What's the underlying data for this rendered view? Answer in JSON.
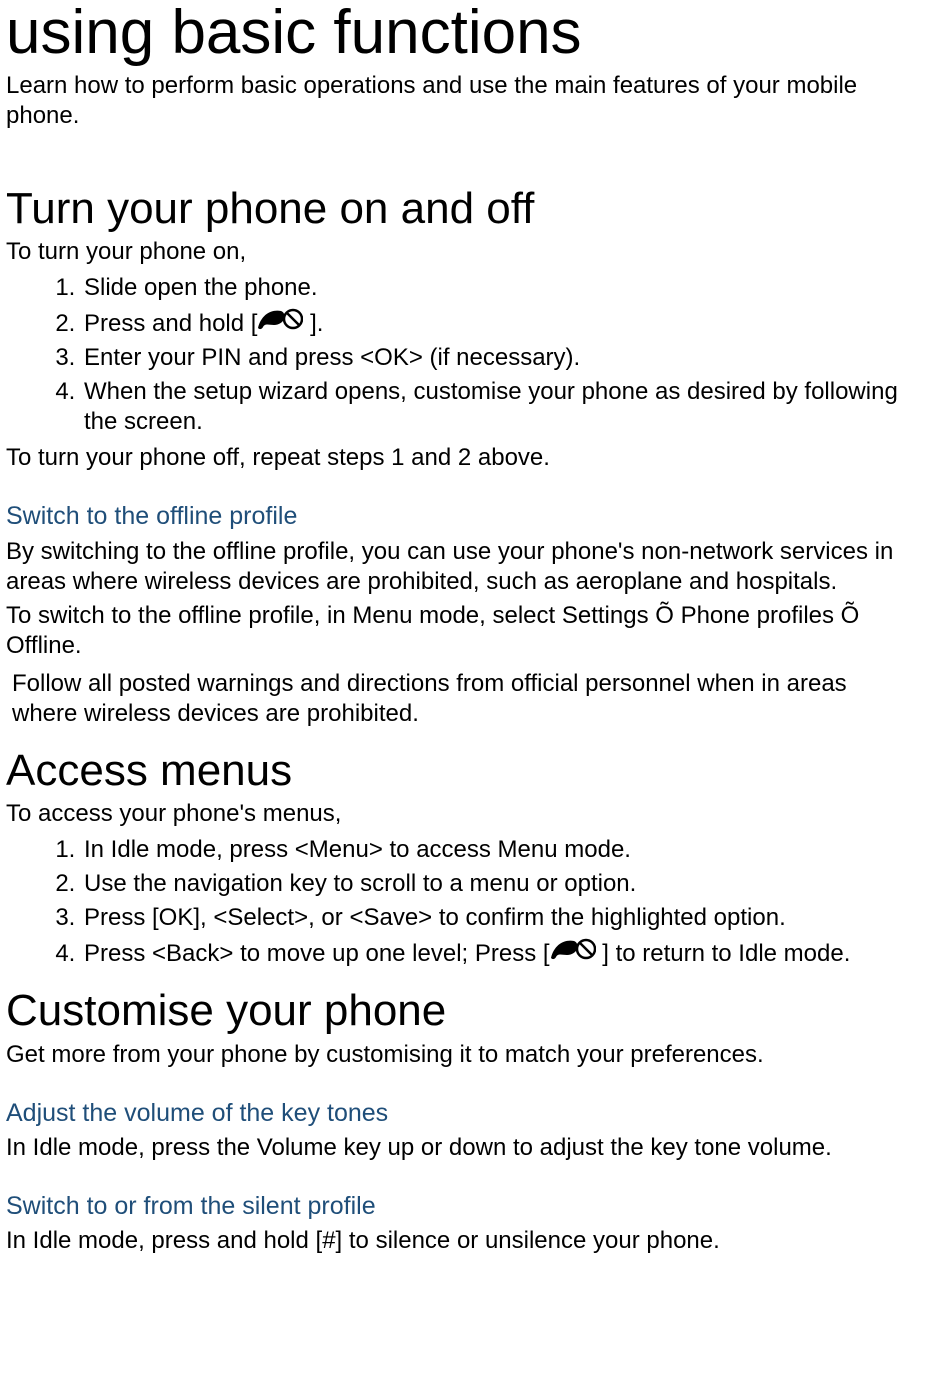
{
  "title": "using basic functions",
  "intro": " Learn how to perform basic operations and use the main features of your mobile phone.",
  "s1": {
    "heading": "Turn your phone on and off",
    "lead": "To turn your phone on,",
    "steps": {
      "a": "Slide open the phone.",
      "b_pre": "Press and hold [",
      "b_post": " ].",
      "c": "Enter your PIN and press <OK> (if necessary).",
      "d": "When the setup wizard opens, customise your phone as desired by following the screen."
    },
    "after": "To turn your phone off, repeat steps 1 and 2 above."
  },
  "offline": {
    "heading": "Switch to the offline profile",
    "p1": "By switching to the offline profile, you can use your phone's non-network services in areas where wireless devices are prohibited, such as aeroplane and hospitals.",
    "p2": "To switch to the offline profile, in Menu mode, select Settings Õ Phone profiles Õ Offline.",
    "note": "Follow all posted warnings and directions from official personnel when in areas where wireless devices are prohibited."
  },
  "s2": {
    "heading": "Access menus",
    "lead": "To access your phone's menus,",
    "steps": {
      "a": "In Idle mode, press <Menu> to access Menu mode.",
      "b": "Use the navigation key to scroll to a menu or option.",
      "c": "Press [OK], <Select>, or <Save> to confirm the highlighted option.",
      "d_pre": "Press <Back> to move up one level; Press [",
      "d_post": " ] to return to Idle mode."
    }
  },
  "s3": {
    "heading": "Customise your phone",
    "lead": "Get more from your phone by customising it to match your preferences."
  },
  "vol": {
    "heading": "Adjust the volume of the key tones",
    "p": "In Idle mode, press the Volume key up or down to adjust the key tone volume."
  },
  "silent": {
    "heading": "Switch to or from the silent profile",
    "p": "In Idle mode, press and hold [#] to silence or unsilence your phone."
  }
}
